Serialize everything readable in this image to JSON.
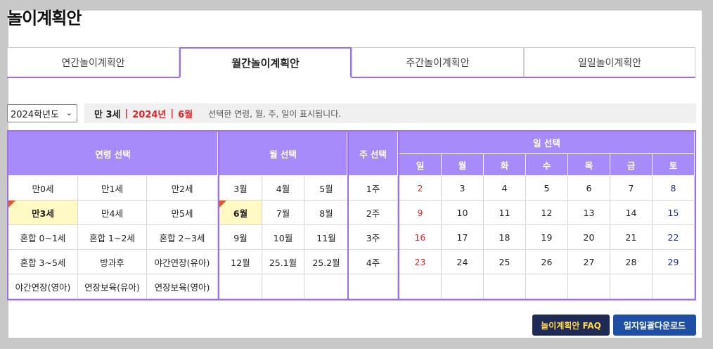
{
  "title": "놀이계획안",
  "tabs": [
    "연간놀이계획안",
    "월간놀이계획안",
    "주간놀이계획안",
    "일일놀이계획안"
  ],
  "active_tab": 1,
  "year_select": {
    "value": "2024학년도"
  },
  "info": {
    "age": "만 3세",
    "sep": "|",
    "year": "2024년",
    "month": "6월",
    "desc": "선택한 연령, 월, 주, 일이 표시됩니다."
  },
  "headers": {
    "age": "연령 선택",
    "month": "월 선택",
    "week": "주 선택",
    "day": "일 선택",
    "weekdays": [
      "일",
      "월",
      "화",
      "수",
      "목",
      "금",
      "토"
    ]
  },
  "ages": [
    [
      "만0세",
      "만1세",
      "만2세"
    ],
    [
      "만3세",
      "만4세",
      "만5세"
    ],
    [
      "혼합 0~1세",
      "혼합 1~2세",
      "혼합 2~3세"
    ],
    [
      "혼합 3~5세",
      "방과후",
      "야간연장(유아)"
    ],
    [
      "야간연장(영아)",
      "연장보육(유아)",
      "연장보육(영아)"
    ]
  ],
  "months": [
    [
      "3월",
      "4월",
      "5월"
    ],
    [
      "6월",
      "7월",
      "8월"
    ],
    [
      "9월",
      "10월",
      "11월"
    ],
    [
      "12월",
      "25.1월",
      "25.2월"
    ],
    [
      "",
      "",
      ""
    ]
  ],
  "weeks": [
    "1주",
    "2주",
    "3주",
    "4주",
    ""
  ],
  "days": [
    [
      "2",
      "3",
      "4",
      "5",
      "6",
      "7",
      "8"
    ],
    [
      "9",
      "10",
      "11",
      "12",
      "13",
      "14",
      "15"
    ],
    [
      "16",
      "17",
      "18",
      "19",
      "20",
      "21",
      "22"
    ],
    [
      "23",
      "24",
      "25",
      "26",
      "27",
      "28",
      "29"
    ],
    [
      "",
      "",
      "",
      "",
      "",
      "",
      ""
    ]
  ],
  "selected": {
    "age_row": 1,
    "age_col": 0,
    "month_row": 1,
    "month_col": 0
  },
  "buttons": {
    "faq": "놀이계획안 FAQ",
    "download": "일지일괄다운로드"
  },
  "colors": {
    "accent": "#9b6ff0",
    "header": "#a78bfa",
    "sunday": "#e0262a",
    "saturday": "#1a2a9c",
    "selected": "#fff9c4"
  }
}
